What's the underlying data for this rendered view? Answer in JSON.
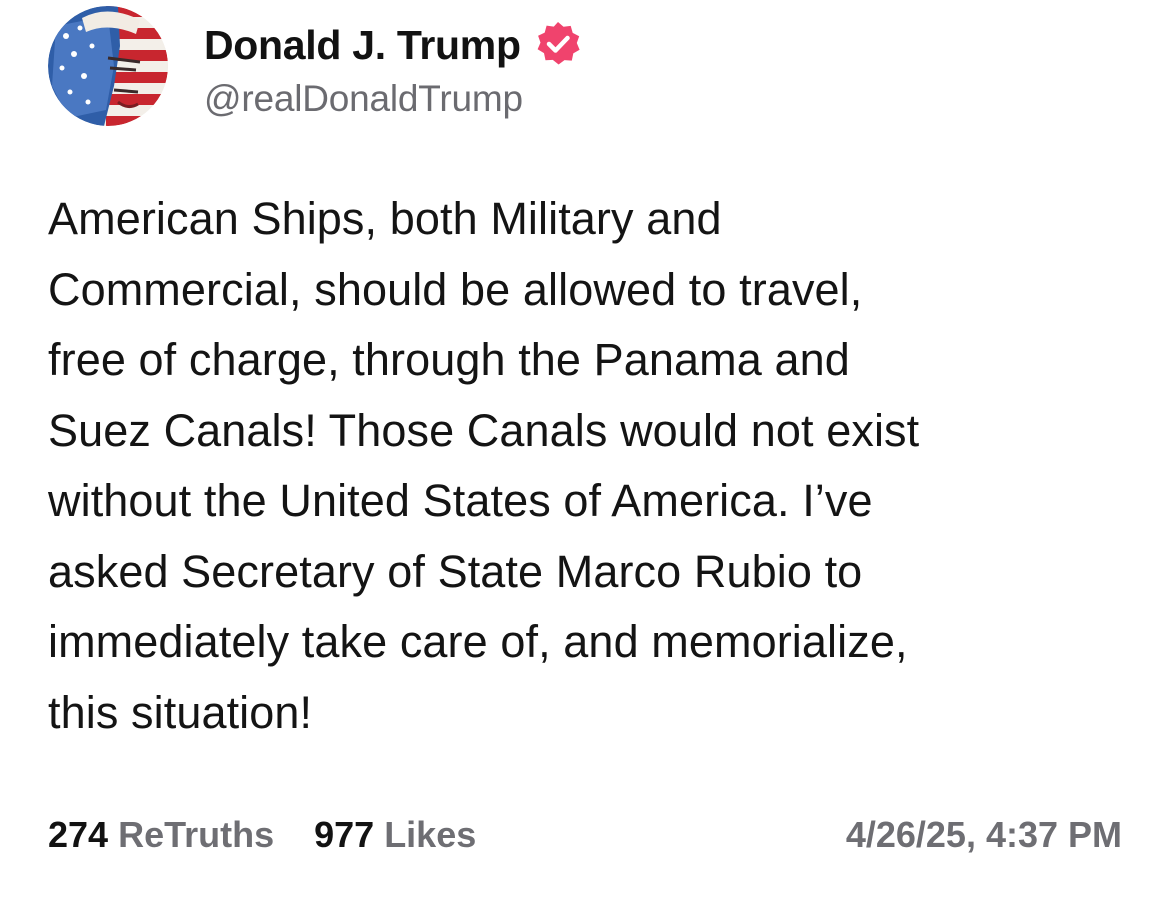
{
  "author": {
    "display_name": "Donald J. Trump",
    "handle": "@realDonaldTrump",
    "avatar_icon": "flag-portrait-avatar",
    "verified_icon": "verified-badge-icon",
    "verified_color": "#f0436d"
  },
  "post": {
    "text": "American Ships, both Military and\nCommercial, should be allowed to travel,\nfree of charge, through the Panama and\nSuez Canals! Those Canals would not exist\nwithout the United States of America. I’ve\nasked Secretary of State Marco Rubio to\nimmediately take care of, and memorialize,\nthis situation!"
  },
  "stats": {
    "retruths_count": "274",
    "retruths_label": "ReTruths",
    "likes_count": "977",
    "likes_label": "Likes",
    "timestamp": "4/26/25, 4:37 PM"
  }
}
